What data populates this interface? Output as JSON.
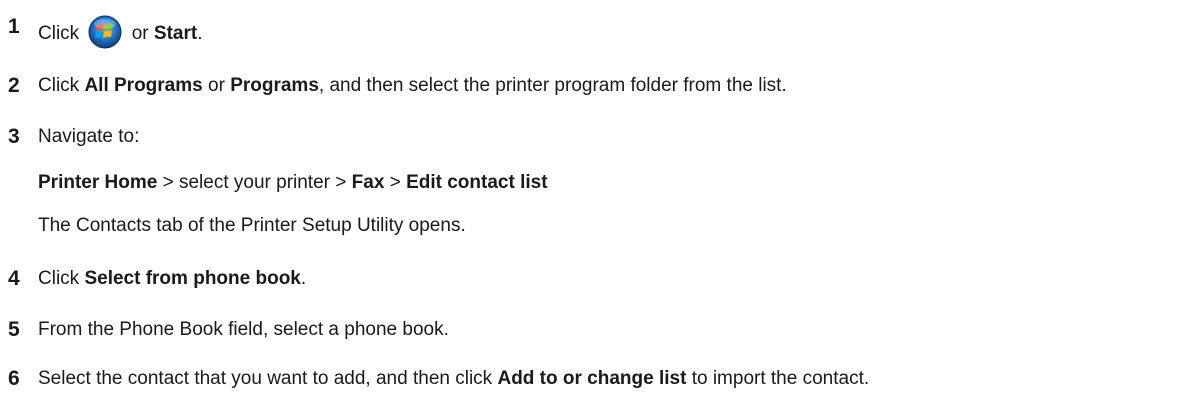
{
  "steps": [
    {
      "num": "1",
      "parts": {
        "a": "Click",
        "icon": "windows-start-orb-icon",
        "b": "or",
        "c": "Start",
        "d": "."
      }
    },
    {
      "num": "2",
      "parts": {
        "a": "Click",
        "b": "All Programs",
        "c": "or",
        "d": "Programs",
        "e": ", and then select the printer program folder from the list."
      }
    },
    {
      "num": "3",
      "parts": {
        "a": "Navigate to:"
      },
      "path": {
        "a": "Printer Home",
        "b": "> select your printer >",
        "c": "Fax",
        "d": ">",
        "e": "Edit contact list"
      },
      "note": "The Contacts tab of the Printer Setup Utility opens."
    },
    {
      "num": "4",
      "parts": {
        "a": "Click",
        "b": "Select from phone book",
        "c": "."
      }
    },
    {
      "num": "5",
      "parts": {
        "a": "From the Phone Book field, select a phone book."
      }
    },
    {
      "num": "6",
      "parts": {
        "a": "Select the contact that you want to add, and then click",
        "b": "Add to or change list",
        "c": "to import the contact."
      }
    }
  ],
  "colors": {
    "text": "#1a1a1a",
    "orb_blue": "#1f6fc5",
    "flag_red": "#f25022",
    "flag_green": "#7fba00",
    "flag_blue": "#00a4ef",
    "flag_yellow": "#ffb900"
  }
}
